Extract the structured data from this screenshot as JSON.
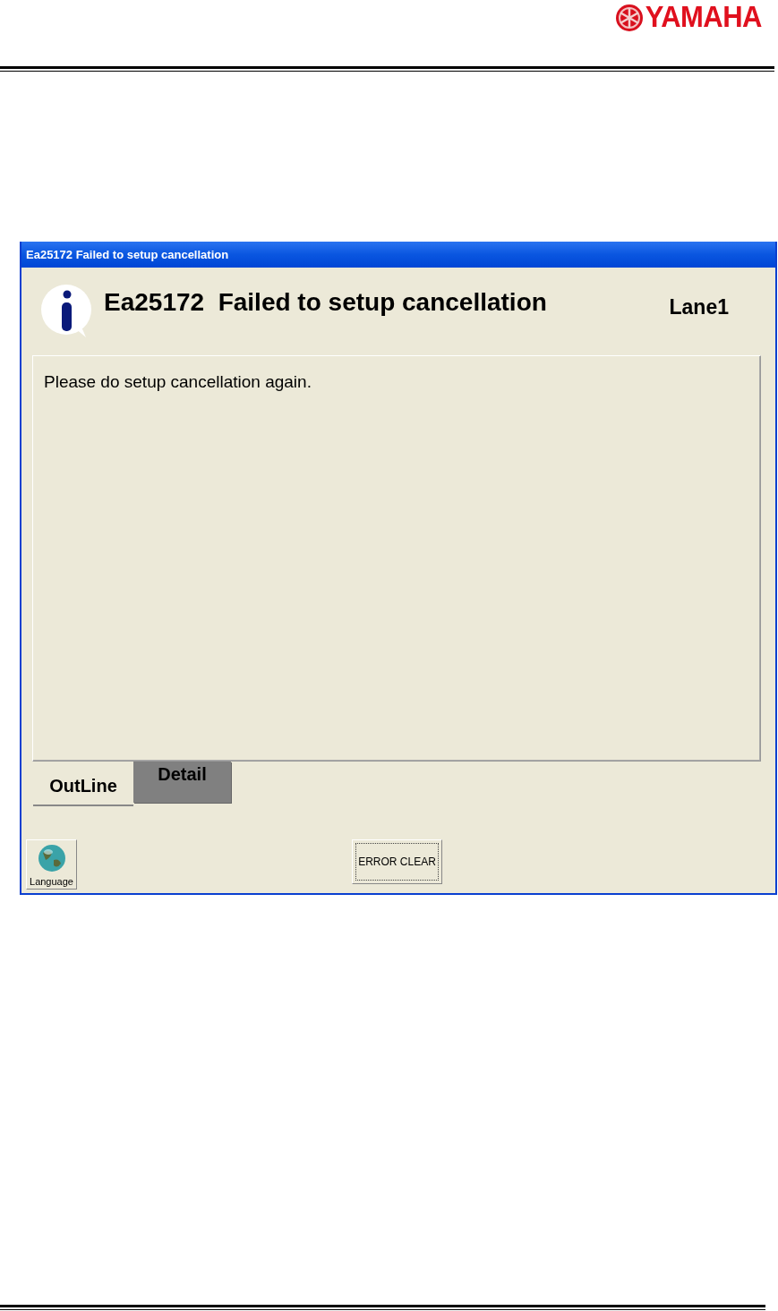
{
  "page_header": {
    "logo": "YAMAHA"
  },
  "window": {
    "title": "Ea25172 Failed to setup cancellation"
  },
  "dialog": {
    "heading": "Ea25172  Failed to setup cancellation",
    "lane": "Lane1",
    "message": "Please do setup cancellation again."
  },
  "tabs": [
    {
      "label": "OutLine",
      "selected": true
    },
    {
      "label": "Detail",
      "selected": false
    }
  ],
  "buttons": {
    "language": "Language",
    "error_clear": "ERROR CLEAR"
  }
}
